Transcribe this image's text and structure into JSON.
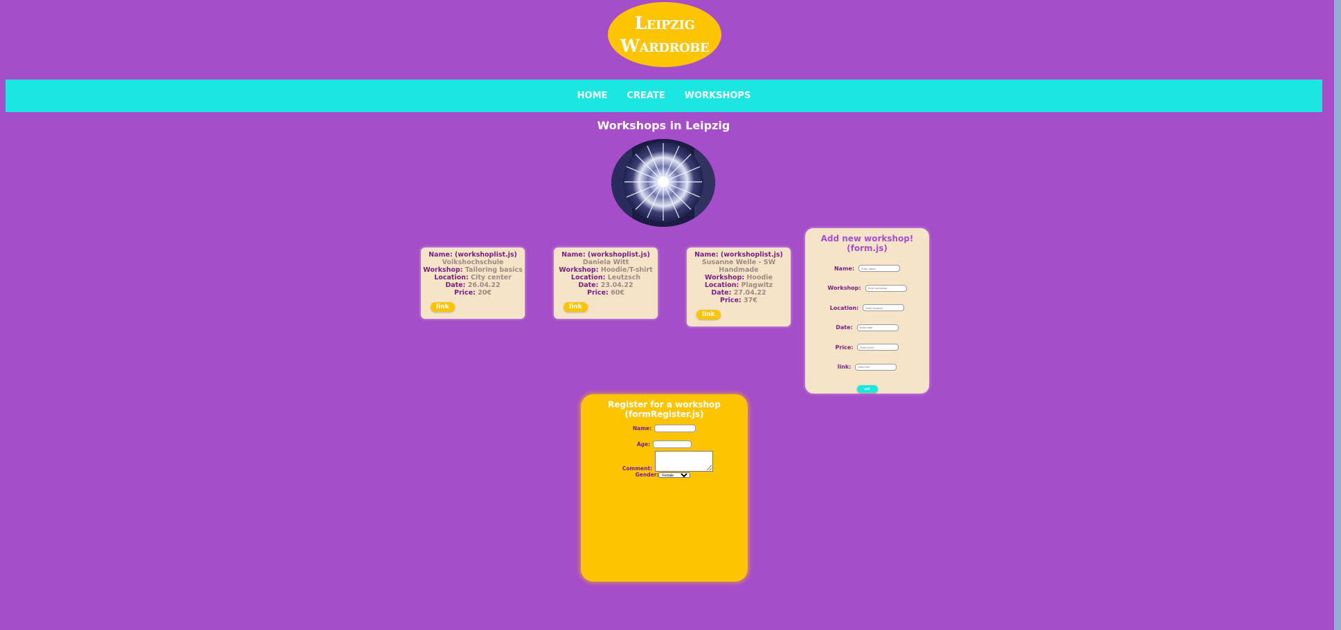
{
  "logo": {
    "line1": "Leipzig",
    "line2": "Wardrobe"
  },
  "nav": {
    "home": "HOME",
    "create": "CREATE",
    "workshops": "WORKSHOPS"
  },
  "page": {
    "title": "Workshops in Leipzig"
  },
  "cards": [
    {
      "name_label": "Name: (workshoplist.js)",
      "name": "Volkshochschule",
      "workshop_label": "Workshop:",
      "workshop": "Tailoring basics",
      "location_label": "Location:",
      "location": "City center",
      "date_label": "Date:",
      "date": "26.04.22",
      "price_label": "Price:",
      "price": "20€",
      "link": "link"
    },
    {
      "name_label": "Name: (workshoplist.js)",
      "name": "Daniela Witt",
      "workshop_label": "Workshop:",
      "workshop": "Hoodie/T-shirt",
      "location_label": "Location:",
      "location": "Leutzsch",
      "date_label": "Date:",
      "date": "23.04.22",
      "price_label": "Price:",
      "price": "60€",
      "link": "link"
    },
    {
      "name_label": "Name: (workshoplist.js)",
      "name": "Susanne Welle - SW Handmade",
      "workshop_label": "Workshop:",
      "workshop": "Hoodie",
      "location_label": "Location:",
      "location": "Plagwitz",
      "date_label": "Date:",
      "date": "27.04.22",
      "price_label": "Price:",
      "price": "37€",
      "link": "link"
    }
  ],
  "add_form": {
    "title": "Add new workshop! (form.js)",
    "fields": [
      {
        "label": "Name:",
        "placeholder": "Enter name"
      },
      {
        "label": "Workshop:",
        "placeholder": "Enter workshop"
      },
      {
        "label": "Location:",
        "placeholder": "Enter location"
      },
      {
        "label": "Date:",
        "placeholder": "Enter date"
      },
      {
        "label": "Price:",
        "placeholder": "Enter price"
      },
      {
        "label": "link:",
        "placeholder": "Enter link"
      }
    ],
    "submit": "add"
  },
  "register": {
    "title_line1": "Register for a workshop",
    "title_line2": "(formRegister.js)",
    "name_label": "Name:",
    "age_label": "Age:",
    "comment_label": "Comment:",
    "gender_label": "Gender:",
    "gender_value": "Female"
  },
  "colors": {
    "background": "#a64dca",
    "nav": "#1be6df",
    "accent_yellow": "#fdc403",
    "card": "#f6e4c9",
    "label_purple": "#7a1f82"
  },
  "hero_image": "tie-dye-fabric-image"
}
